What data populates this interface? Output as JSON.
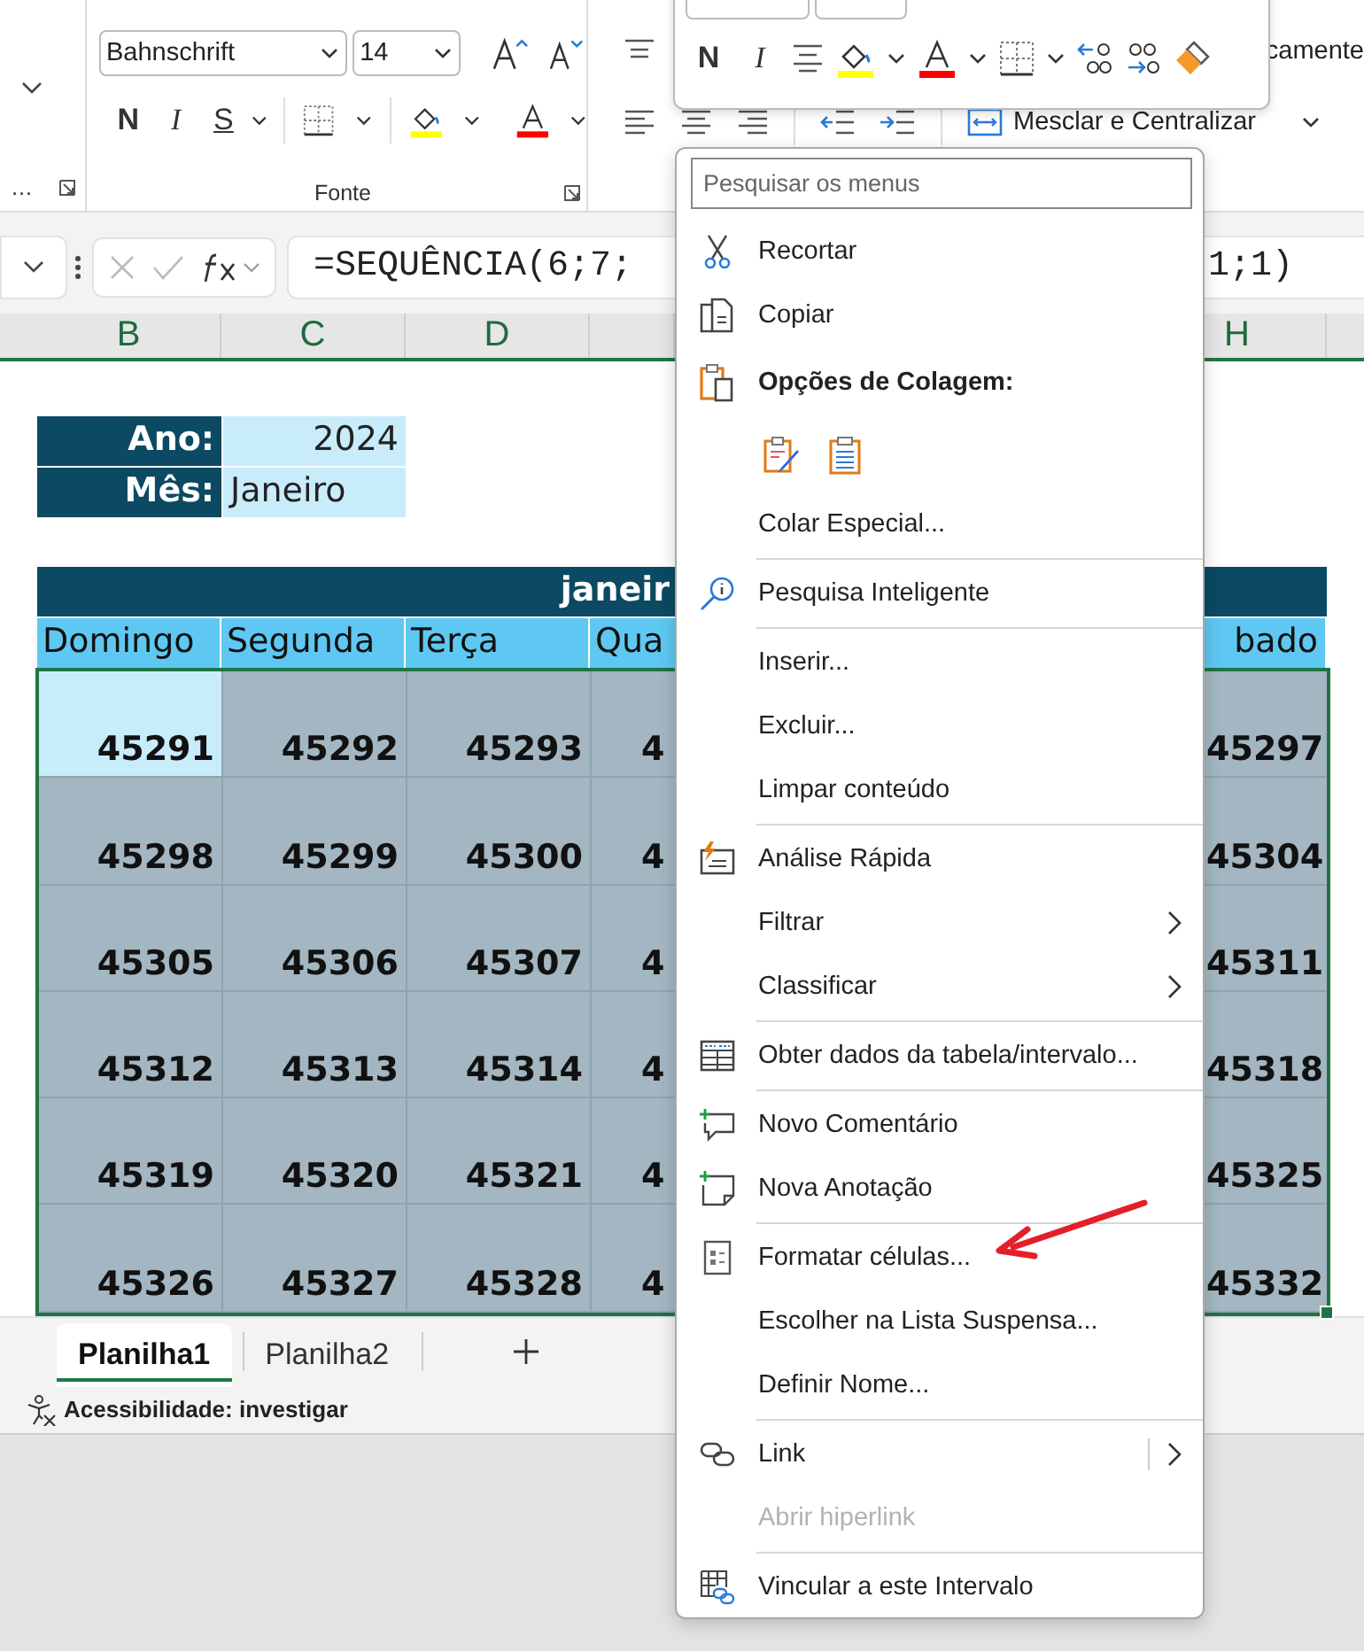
{
  "ribbon": {
    "clipboard_group_fragment": "…",
    "font_name": "Bahnschrift",
    "font_size": "14",
    "bold_label": "N",
    "italic_label": "I",
    "underline_label": "S",
    "font_group_label": "Fonte",
    "wrap_text_fragment": "camente",
    "merge_label": "Mesclar e Centralizar"
  },
  "mini_toolbar": {
    "bold_label": "N",
    "italic_label": "I"
  },
  "formula_bar": {
    "formula_visible": "=SEQUÊNCIA(6;7;",
    "formula_tail": "1;1)"
  },
  "column_headers": [
    {
      "label": "B",
      "selected": true
    },
    {
      "label": "C",
      "selected": true
    },
    {
      "label": "D",
      "selected": true
    },
    {
      "label": "H",
      "selected": true
    }
  ],
  "info": [
    {
      "label": "Ano:",
      "value": "2024",
      "kind": "number"
    },
    {
      "label": "Mês:",
      "value": "Janeiro",
      "kind": "text"
    }
  ],
  "calendar": {
    "title_visible": "janeir",
    "day_headers": [
      "Domingo",
      "Segunda",
      "Terça",
      "Qua",
      "bado"
    ],
    "rows": [
      {
        "cells": [
          {
            "text": "45291",
            "active": true
          },
          {
            "text": "45292",
            "active": false
          },
          {
            "text": "45293",
            "active": false
          },
          {
            "text": "4",
            "active": false
          },
          {
            "text": "45297",
            "active": false
          }
        ]
      },
      {
        "cells": [
          {
            "text": "45298",
            "active": false
          },
          {
            "text": "45299",
            "active": false
          },
          {
            "text": "45300",
            "active": false
          },
          {
            "text": "4",
            "active": false
          },
          {
            "text": "45304",
            "active": false
          }
        ]
      },
      {
        "cells": [
          {
            "text": "45305",
            "active": false
          },
          {
            "text": "45306",
            "active": false
          },
          {
            "text": "45307",
            "active": false
          },
          {
            "text": "4",
            "active": false
          },
          {
            "text": "45311",
            "active": false
          }
        ]
      },
      {
        "cells": [
          {
            "text": "45312",
            "active": false
          },
          {
            "text": "45313",
            "active": false
          },
          {
            "text": "45314",
            "active": false
          },
          {
            "text": "4",
            "active": false
          },
          {
            "text": "45318",
            "active": false
          }
        ]
      },
      {
        "cells": [
          {
            "text": "45319",
            "active": false
          },
          {
            "text": "45320",
            "active": false
          },
          {
            "text": "45321",
            "active": false
          },
          {
            "text": "4",
            "active": false
          },
          {
            "text": "45325",
            "active": false
          }
        ]
      },
      {
        "cells": [
          {
            "text": "45326",
            "active": false
          },
          {
            "text": "45327",
            "active": false
          },
          {
            "text": "45328",
            "active": false
          },
          {
            "text": "4",
            "active": false
          },
          {
            "text": "45332",
            "active": false
          }
        ]
      }
    ]
  },
  "context_menu": {
    "search_placeholder": "Pesquisar os menus",
    "items": [
      {
        "kind": "item",
        "label": "Recortar",
        "disabled": false,
        "submenu": false,
        "split": false
      },
      {
        "kind": "item",
        "label": "Copiar",
        "disabled": false,
        "submenu": false,
        "split": false
      },
      {
        "kind": "header",
        "label": "Opções de Colagem:"
      },
      {
        "kind": "paste_options"
      },
      {
        "kind": "item",
        "label": "Colar Especial...",
        "disabled": false,
        "submenu": false,
        "split": false
      },
      {
        "kind": "separator"
      },
      {
        "kind": "item",
        "label": "Pesquisa Inteligente",
        "disabled": false,
        "submenu": false,
        "split": false
      },
      {
        "kind": "separator"
      },
      {
        "kind": "item",
        "label": "Inserir...",
        "disabled": false,
        "submenu": false,
        "split": false
      },
      {
        "kind": "item",
        "label": "Excluir...",
        "disabled": false,
        "submenu": false,
        "split": false
      },
      {
        "kind": "item",
        "label": "Limpar conteúdo",
        "disabled": false,
        "submenu": false,
        "split": false
      },
      {
        "kind": "separator"
      },
      {
        "kind": "item",
        "label": "Análise Rápida",
        "disabled": false,
        "submenu": false,
        "split": false
      },
      {
        "kind": "item",
        "label": "Filtrar",
        "disabled": false,
        "submenu": true,
        "split": false
      },
      {
        "kind": "item",
        "label": "Classificar",
        "disabled": false,
        "submenu": true,
        "split": false
      },
      {
        "kind": "separator"
      },
      {
        "kind": "item",
        "label": "Obter dados da tabela/intervalo...",
        "disabled": false,
        "submenu": false,
        "split": false
      },
      {
        "kind": "separator"
      },
      {
        "kind": "item",
        "label": "Novo Comentário",
        "disabled": false,
        "submenu": false,
        "split": false
      },
      {
        "kind": "item",
        "label": "Nova Anotação",
        "disabled": false,
        "submenu": false,
        "split": false
      },
      {
        "kind": "separator"
      },
      {
        "kind": "item",
        "label": "Formatar células...",
        "disabled": false,
        "submenu": false,
        "split": false
      },
      {
        "kind": "item",
        "label": "Escolher na Lista Suspensa...",
        "disabled": false,
        "submenu": false,
        "split": false
      },
      {
        "kind": "item",
        "label": "Definir Nome...",
        "disabled": false,
        "submenu": false,
        "split": false
      },
      {
        "kind": "separator"
      },
      {
        "kind": "item",
        "label": "Link",
        "disabled": false,
        "submenu": true,
        "split": true
      },
      {
        "kind": "item",
        "label": "Abrir hiperlink",
        "disabled": true,
        "submenu": false,
        "split": false
      },
      {
        "kind": "separator"
      },
      {
        "kind": "item",
        "label": "Vincular a este Intervalo",
        "disabled": false,
        "submenu": false,
        "split": false
      }
    ]
  },
  "sheet_tabs": [
    {
      "label": "Planilha1",
      "selected": true
    },
    {
      "label": "Planilha2",
      "selected": false
    }
  ],
  "status_bar": {
    "accessibility": "Acessibilidade: investigar"
  }
}
